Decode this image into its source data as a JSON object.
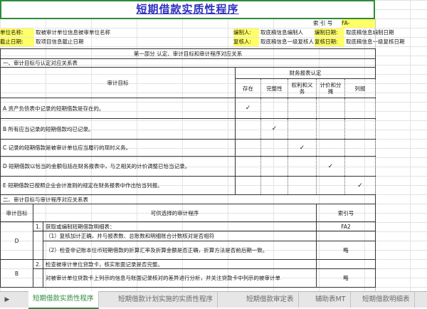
{
  "sheet": {
    "title": "短期借款实质性程序",
    "ref_label": "索   引   号",
    "ref_value": "FA-",
    "unit_label": "单位名称:",
    "unit_value": "取被审计单位信息被审单位名称",
    "compiler_label": "编制人:",
    "compiler_value": "取底稿信息编制人",
    "compile_date_label": "编制日期:",
    "compile_date_value": "取底稿信息编制日期",
    "cutoff_label": "截止日期:",
    "cutoff_value": "取项目信息截止日期",
    "reviewer_label": "复核人:",
    "reviewer_value": "取底稿信息一级复核人",
    "review_date_label": "复核日期:",
    "review_date_value": "取底稿信息一级复核日期"
  },
  "part1": {
    "heading": "第一部分  认定、审计目标和审计程序对应关系",
    "section1": "一、审计目标与认定对应关系表",
    "financial_header": "财务报表认定",
    "goal_header": "审计目标",
    "cols": [
      "存在",
      "完整性",
      "权利和义务",
      "计价和分摊",
      "列报"
    ],
    "goals": [
      {
        "text": "A 资产负债表中记录的短期借款是存在的。",
        "checks": [
          "✓",
          "",
          "",
          "",
          ""
        ]
      },
      {
        "text": "B 所有应当记录的短期借款均已记录。",
        "checks": [
          "",
          "✓",
          "",
          "",
          ""
        ]
      },
      {
        "text": "C 记录的短期借款是被审计单位应当履行的现时义务。",
        "checks": [
          "",
          "",
          "✓",
          "",
          ""
        ]
      },
      {
        "text": "D 短期借款以恰当的金额包括在财务报表中，与之相关的计价调整已恰当记录。",
        "checks": [
          "",
          "",
          "",
          "✓",
          ""
        ]
      },
      {
        "text": "E 短期借款已按照企业会计准则的规定在财务报表中作出恰当列报。",
        "checks": [
          "",
          "",
          "",
          "",
          "✓"
        ]
      }
    ],
    "section2": "二、审计目标与审计程序对应关系表",
    "proc_goal_header": "审计目标",
    "proc_header": "可供选择的审计程序",
    "ref_header": "索引号",
    "procedures": [
      {
        "goal": "D",
        "num": "1.",
        "title": "获取或编制短期借款明细表：",
        "ref": "FA2",
        "items": [
          {
            "text": "（1）复核加计正确，并与报表数、总账数和明细账合计数核对是否相符",
            "ref": ""
          },
          {
            "text": "（2）检查非记账本位币短期借款的折算汇率及折算金额是否正确，折算方法是否前后期一致。",
            "ref": "略"
          }
        ]
      },
      {
        "goal": "B",
        "num": "2.",
        "title": "检查被审计单位贷款卡，核实账面记录是否完整。",
        "ref": "",
        "items": [
          {
            "text": "对被审计单位贷款卡上列示的信息与账面记录核对的差异进行分析，并关注贷款卡中列示的被审计单",
            "ref": "略"
          }
        ]
      }
    ]
  },
  "tabs": {
    "nav": "▶",
    "items": [
      "短期借款实质性程序",
      "短期借款计划实施的实质性程序",
      "短期借款审定表",
      "辅助表MT",
      "短期借款明细表"
    ]
  }
}
